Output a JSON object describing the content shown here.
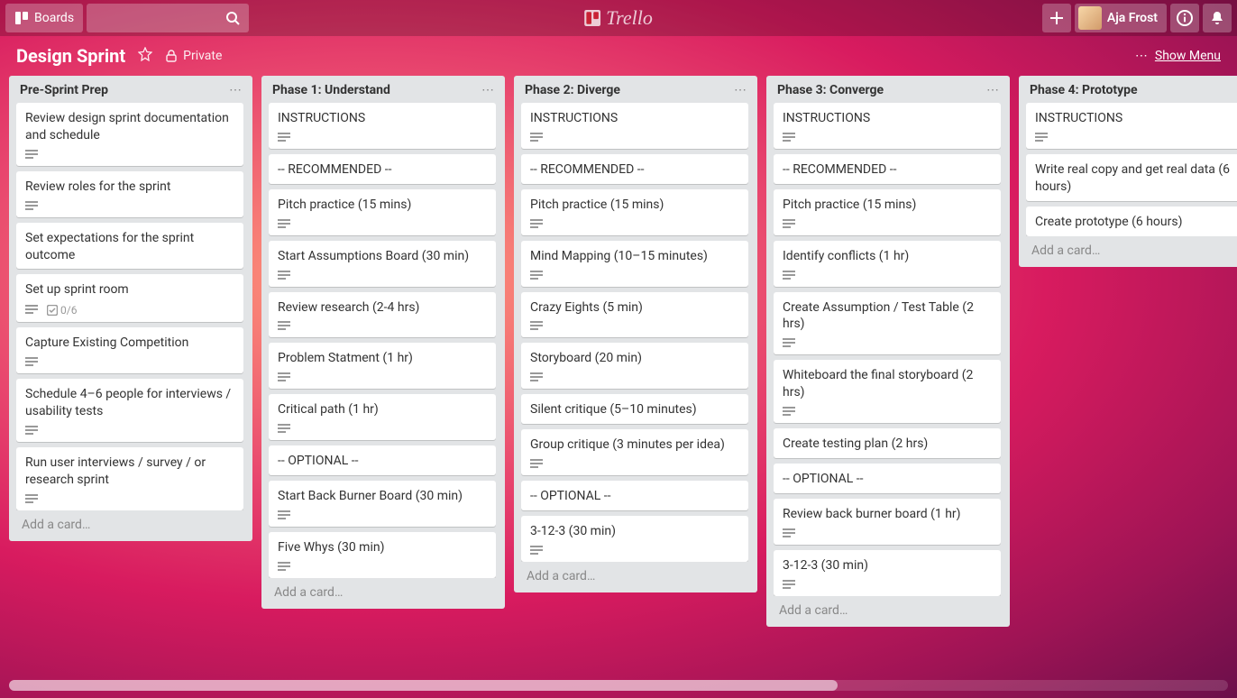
{
  "header": {
    "boards_label": "Boards",
    "user_name": "Aja Frost",
    "logo_text": "Trello"
  },
  "board": {
    "name": "Design Sprint",
    "privacy": "Private",
    "show_menu": "Show Menu",
    "add_card_label": "Add a card…"
  },
  "lists": [
    {
      "title": "Pre-Sprint Prep",
      "cards": [
        {
          "title": "Review design sprint documentation and schedule",
          "desc": true
        },
        {
          "title": "Review roles for the sprint",
          "desc": true
        },
        {
          "title": "Set expectations for the sprint outcome"
        },
        {
          "title": "Set up sprint room",
          "desc": true,
          "checklist": "0/6"
        },
        {
          "title": "Capture Existing Competition",
          "desc": true
        },
        {
          "title": "Schedule 4–6 people for interviews / usability tests",
          "desc": true
        },
        {
          "title": "Run user interviews / survey / or research sprint",
          "desc": true
        }
      ]
    },
    {
      "title": "Phase 1: Understand",
      "cards": [
        {
          "title": "INSTRUCTIONS",
          "desc": true
        },
        {
          "title": "-- RECOMMENDED --"
        },
        {
          "title": "Pitch practice (15 mins)",
          "desc": true
        },
        {
          "title": "Start Assumptions Board (30 min)",
          "desc": true
        },
        {
          "title": "Review research (2-4 hrs)",
          "desc": true
        },
        {
          "title": "Problem Statment (1 hr)",
          "desc": true
        },
        {
          "title": "Critical path (1 hr)",
          "desc": true
        },
        {
          "title": "-- OPTIONAL --"
        },
        {
          "title": "Start Back Burner Board (30 min)",
          "desc": true
        },
        {
          "title": "Five Whys (30 min)",
          "desc": true
        }
      ]
    },
    {
      "title": "Phase 2: Diverge",
      "cards": [
        {
          "title": "INSTRUCTIONS",
          "desc": true
        },
        {
          "title": "-- RECOMMENDED --"
        },
        {
          "title": "Pitch practice (15 mins)",
          "desc": true
        },
        {
          "title": "Mind Mapping (10–15 minutes)",
          "desc": true
        },
        {
          "title": "Crazy Eights (5 min)",
          "desc": true
        },
        {
          "title": "Storyboard (20 min)",
          "desc": true
        },
        {
          "title": "Silent critique (5–10 minutes)"
        },
        {
          "title": "Group critique (3 minutes per idea)",
          "desc": true
        },
        {
          "title": "-- OPTIONAL --"
        },
        {
          "title": "3-12-3 (30 min)",
          "desc": true
        }
      ]
    },
    {
      "title": "Phase 3: Converge",
      "cards": [
        {
          "title": "INSTRUCTIONS",
          "desc": true
        },
        {
          "title": "-- RECOMMENDED --"
        },
        {
          "title": "Pitch practice (15 mins)",
          "desc": true
        },
        {
          "title": "Identify conflicts (1 hr)",
          "desc": true
        },
        {
          "title": "Create Assumption / Test Table (2 hrs)",
          "desc": true
        },
        {
          "title": "Whiteboard the final storyboard (2 hrs)",
          "desc": true
        },
        {
          "title": "Create testing plan (2 hrs)"
        },
        {
          "title": "-- OPTIONAL --"
        },
        {
          "title": "Review back burner board (1 hr)",
          "desc": true
        },
        {
          "title": "3-12-3 (30 min)",
          "desc": true
        }
      ]
    },
    {
      "title": "Phase 4: Prototype",
      "cards": [
        {
          "title": "INSTRUCTIONS",
          "desc": true
        },
        {
          "title": "Write real copy and get real data (6 hours)"
        },
        {
          "title": "Create prototype (6 hours)"
        }
      ]
    }
  ]
}
